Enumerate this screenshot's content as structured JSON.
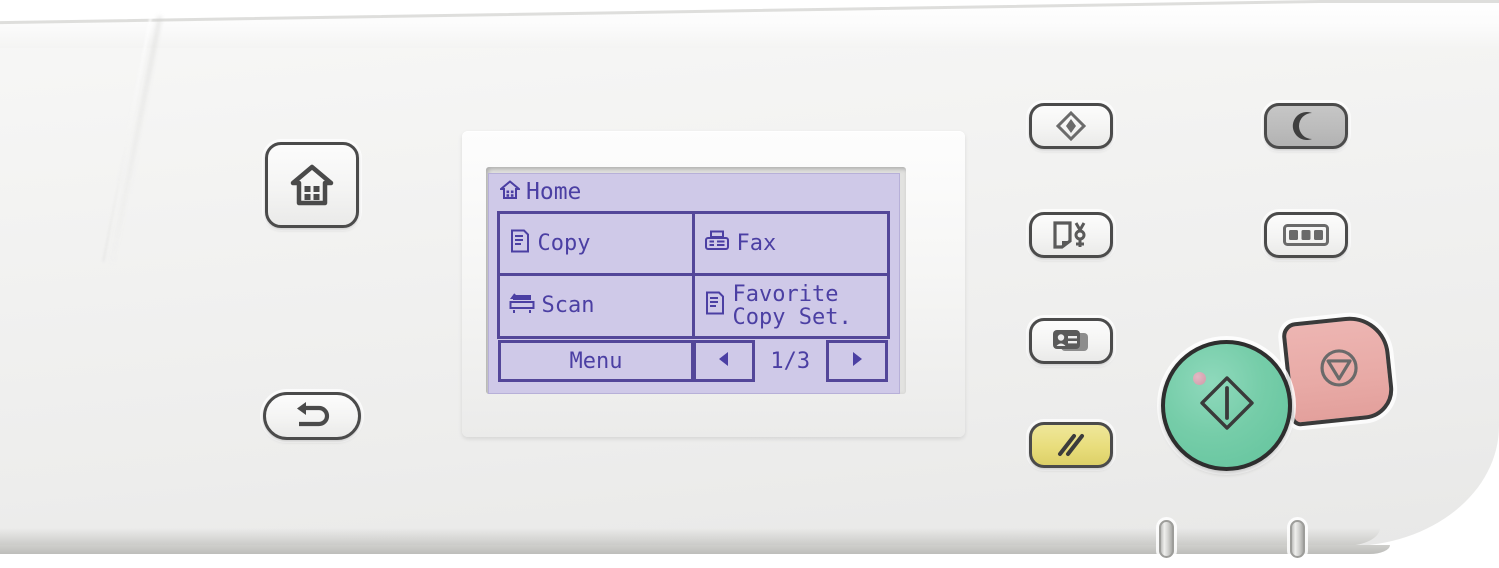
{
  "device": {
    "name": "printer-control-panel",
    "body_color": "#f2f2f1"
  },
  "lcd": {
    "screen_bg": "#cfc9e8",
    "ink_color": "#4b3fa3",
    "title": "Home",
    "title_icon": "home-icon",
    "tiles": [
      {
        "label": "Copy",
        "icon": "copy-document-icon"
      },
      {
        "label": "Fax",
        "icon": "fax-machine-icon"
      },
      {
        "label": "Scan",
        "icon": "scanner-icon"
      },
      {
        "label": "Favorite\nCopy Set.",
        "icon": "favorite-copy-icon"
      }
    ],
    "menu_label": "Menu",
    "page_indicator": "1/3",
    "prev_icon": "triangle-left-icon",
    "next_icon": "triangle-right-icon"
  },
  "keys": {
    "home": {
      "name": "home-key",
      "icon": "house-icon"
    },
    "back": {
      "name": "back-key",
      "icon": "return-arrow-icon"
    },
    "eco": {
      "name": "eco-energy-key",
      "icon": "diamond-eco-icon"
    },
    "paper": {
      "name": "paper-settings-key",
      "icon": "paper-wrench-icon"
    },
    "idcard": {
      "name": "id-card-copy-key",
      "icon": "id-card-icon"
    },
    "clear": {
      "name": "clear-reset-key",
      "icon": "double-slash-icon",
      "color": "#e8dd7c"
    },
    "sleep": {
      "name": "sleep-energy-saver-key",
      "icon": "crescent-moon-icon",
      "color": "#bcbcbc"
    },
    "numeric": {
      "name": "numeric-keypad-key",
      "icon": "numeric-123-icon"
    },
    "start": {
      "name": "start-key",
      "icon": "diamond-start-icon",
      "color": "#76cda9",
      "led": "status-led"
    },
    "stop": {
      "name": "stop-key",
      "icon": "stop-triangle-icon",
      "color": "#e8aaa6"
    }
  },
  "indicators": {
    "slot_1": "led-indicator-slot-left",
    "slot_2": "led-indicator-slot-right"
  }
}
